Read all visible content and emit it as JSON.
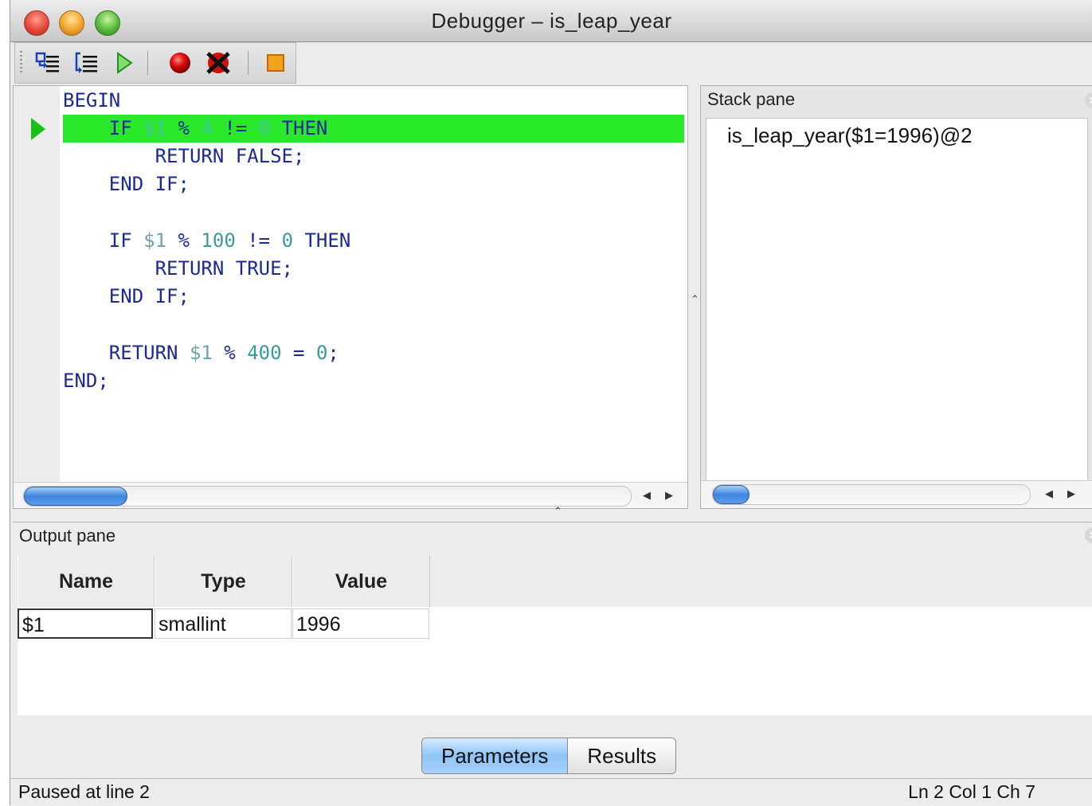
{
  "window": {
    "title": "Debugger – is_leap_year"
  },
  "toolbar": {
    "buttons": [
      {
        "name": "step-into",
        "icon": "step-into-icon"
      },
      {
        "name": "step-over",
        "icon": "step-over-icon"
      },
      {
        "name": "continue",
        "icon": "play-icon"
      },
      {
        "name": "set-breakpoint",
        "icon": "breakpoint-icon"
      },
      {
        "name": "clear-breakpoints",
        "icon": "clear-breakpoints-icon"
      },
      {
        "name": "stop",
        "icon": "stop-icon"
      }
    ]
  },
  "editor": {
    "current_line": 2,
    "lines": [
      "BEGIN",
      "    IF $1 % 4 != 0 THEN",
      "        RETURN FALSE;",
      "    END IF;",
      "",
      "    IF $1 % 100 != 0 THEN",
      "        RETURN TRUE;",
      "    END IF;",
      "",
      "    RETURN $1 % 400 = 0;",
      "END;"
    ]
  },
  "stack_pane": {
    "title": "Stack pane",
    "frames": [
      "is_leap_year($1=1996)@2"
    ]
  },
  "output_pane": {
    "title": "Output pane",
    "columns": [
      "Name",
      "Type",
      "Value"
    ],
    "rows": [
      {
        "name": "$1",
        "type": "smallint",
        "value": "1996"
      }
    ],
    "tabs": [
      {
        "label": "Parameters",
        "active": true
      },
      {
        "label": "Results",
        "active": false
      }
    ]
  },
  "status": {
    "left": "Paused at line 2",
    "right": "Ln 2 Col 1 Ch 7"
  },
  "colors": {
    "current_line_highlight": "#2ae82a",
    "keyword": "#1c2a96",
    "number": "#3a9a9a"
  }
}
